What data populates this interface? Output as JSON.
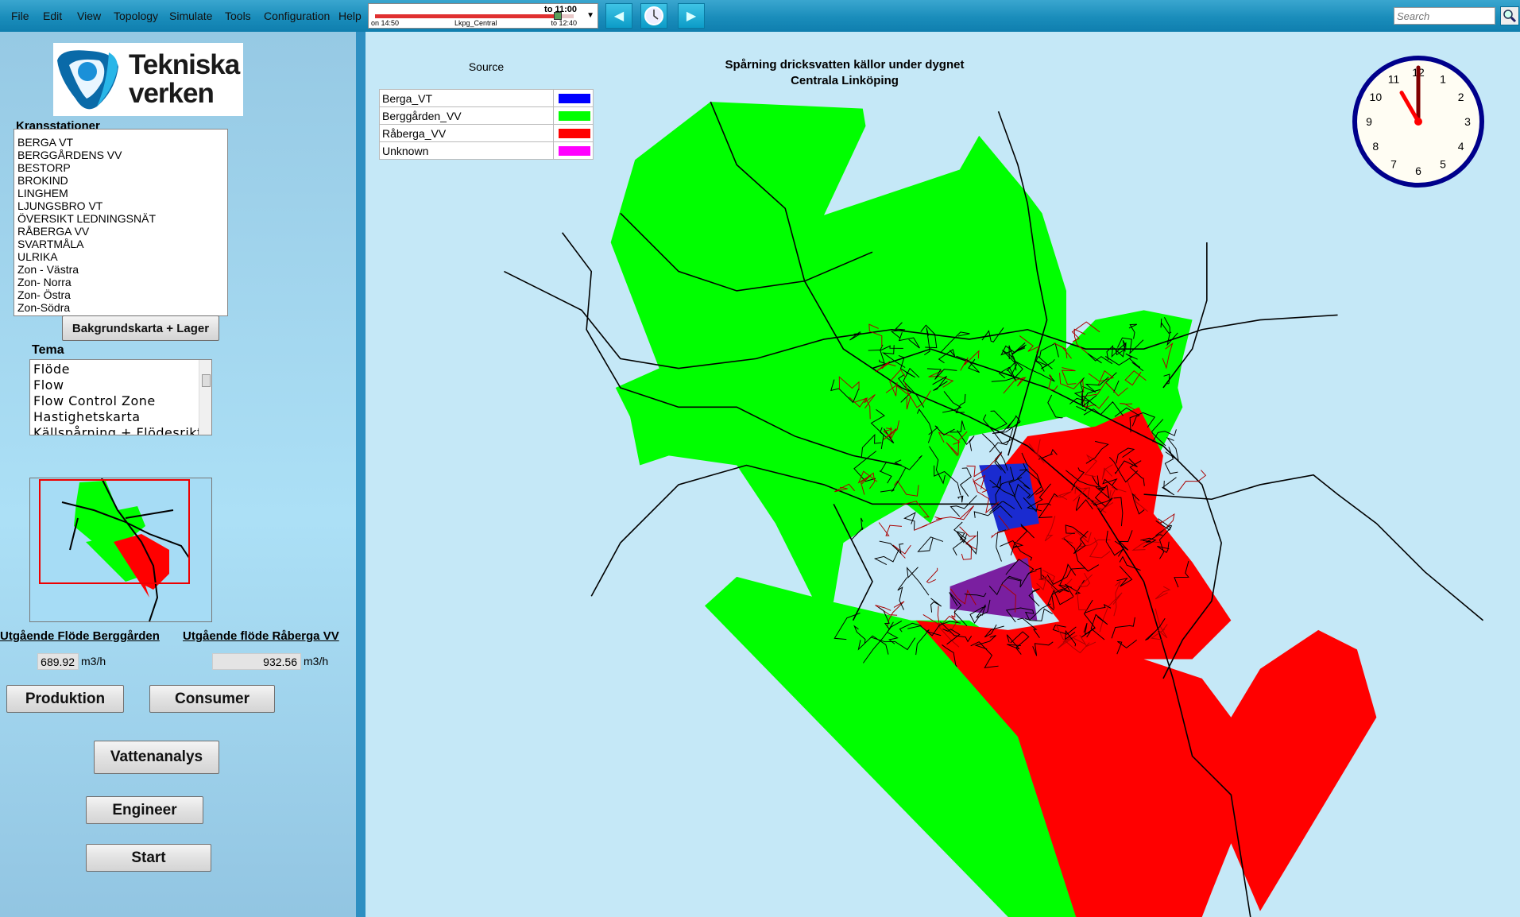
{
  "menu": [
    "File",
    "Edit",
    "View",
    "Topology",
    "Simulate",
    "Tools",
    "Configuration",
    "Help"
  ],
  "timeline": {
    "current": "to 11:00",
    "start": "on 14:50",
    "scenario": "Lkpg_Central",
    "end": "to 12:40",
    "progress": 0.92
  },
  "search": {
    "placeholder": "Search"
  },
  "logo": {
    "text_line1": "Tekniska",
    "text_line2": "verken"
  },
  "kransstationer": {
    "label": "Kransstationer",
    "items": [
      "BERGA VT",
      "BERGGÅRDENS VV",
      "BESTORP",
      "BROKIND",
      "LINGHEM",
      "LJUNGSBRO VT",
      "ÖVERSIKT LEDNINGSNÄT",
      "RÅBERGA VV",
      "SVARTMÅLA",
      "ULRIKA",
      "Zon - Västra",
      "Zon- Norra",
      "Zon- Östra",
      "Zon-Södra"
    ]
  },
  "bakgrund_button": "Bakgrundskarta + Lager",
  "tema": {
    "label": "Tema",
    "items": [
      "Flöde",
      "Flow",
      "Flow Control Zone",
      "Hastighetskarta",
      "Källspårning + Flödesrikt"
    ]
  },
  "flows": [
    {
      "label": "Utgående Flöde Berggården",
      "value": "689.92",
      "unit": "m3/h"
    },
    {
      "label": "Utgående flöde Råberga VV",
      "value": "932.56",
      "unit": "m3/h"
    }
  ],
  "buttons": {
    "produktion": "Produktion",
    "consumer": "Consumer",
    "vattenanalys": "Vattenanalys",
    "engineer": "Engineer",
    "start": "Start"
  },
  "map": {
    "title_line1": "Spårning dricksvatten källor under dygnet",
    "title_line2": "Centrala Linköping",
    "legend_title": "Source",
    "legend": [
      {
        "name": "Berga_VT",
        "color": "#0000ff"
      },
      {
        "name": "Berggården_VV",
        "color": "#00ff00"
      },
      {
        "name": "Råberga_VV",
        "color": "#ff0000"
      },
      {
        "name": "Unknown",
        "color": "#ff00ff"
      }
    ]
  },
  "clock": {
    "hour": 11,
    "minute": 0,
    "numbers": [
      "12",
      "1",
      "2",
      "3",
      "4",
      "5",
      "6",
      "7",
      "8",
      "9",
      "10",
      "11"
    ]
  }
}
